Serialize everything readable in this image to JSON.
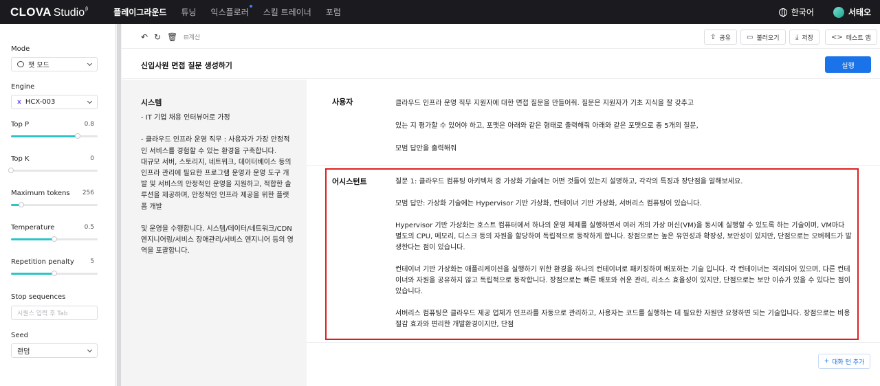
{
  "topnav": {
    "logo_bold": "CLOVA",
    "logo_regular": "Studio",
    "logo_sup": "β",
    "items": [
      {
        "label": "플레이그라운드",
        "active": true
      },
      {
        "label": "튜닝",
        "active": false
      },
      {
        "label": "익스플로러",
        "active": false,
        "dot": true
      },
      {
        "label": "스킬 트레이너",
        "active": false
      },
      {
        "label": "포럼",
        "active": false
      }
    ],
    "language": "한국어",
    "user_name": "서태오"
  },
  "sidebar": {
    "mode_label": "Mode",
    "mode_value": "챗 모드",
    "engine_label": "Engine",
    "engine_value": "HCX-003",
    "top_p_label": "Top P",
    "top_p_value": "0.8",
    "top_k_label": "Top K",
    "top_k_value": "0",
    "max_tokens_label": "Maximum tokens",
    "max_tokens_value": "256",
    "temperature_label": "Temperature",
    "temperature_value": "0.5",
    "repetition_label": "Repetition penalty",
    "repetition_value": "5",
    "stop_label": "Stop sequences",
    "stop_placeholder": "시퀀스 입력 후 Tab",
    "seed_label": "Seed",
    "seed_value": "랜덤",
    "accent_color": "#2cc4c9"
  },
  "toolbar": {
    "token_label": "계산",
    "share": "공유",
    "load": "불러오기",
    "save": "저장",
    "test_app": "테스트 앱"
  },
  "main": {
    "title": "신입사원 면접 질문 생성하기",
    "run_label": "실행",
    "system_title": "시스템",
    "system_text": "- IT 기업 채용 인터뷰어로 가정\n\n- 클라우드 인프라 운영 직무 : 사용자가 가장 안정적인 서비스를 경험할 수 있는 환경을 구축합니다.\n대규모 서버, 스토리지, 네트워크, 데이터베이스 등의 인프라 관리에 필요한 프로그램 운영과 운영 도구 개발 및 서비스의 안정적인 운영을 지원하고, 적합한 솔루션을 제공하며, 안정적인 인프라 제공을 위한 플랫폼 개발\n\n및 운영을 수행합니다. 시스템/데이터/네트워크/CDN 엔지니어링/서비스 장애관리/서비스 엔지니어 등의 영역을 포괄합니다.",
    "user_role": "사용자",
    "user_lines": [
      "클라우드 인프라 운영 직무 지원자에 대한 면접 질문을 만들어줘. 질문은 지원자가 기초 지식을 잘 갖추고",
      "있는 지 평가할 수 있어야 하고, 포맷은 아래와 같은 형태로 출력해줘 아래와 같은 포맷으로 총 5개의 질문,",
      "모범 답안을 출력해줘"
    ],
    "assistant_role": "어시스턴트",
    "assistant_paragraphs": [
      "질문 1: 클라우드 컴퓨팅 아키텍처 중 가상화 기술에는 어떤 것들이 있는지 설명하고, 각각의 특징과 장단점을 말해보세요.",
      "모범 답안: 가상화 기술에는 Hypervisor 기반 가상화, 컨테이너 기반 가상화, 서버리스 컴퓨팅이 있습니다.",
      "Hypervisor 기반 가상화는 호스트 컴퓨터에서 하나의 운영 체제를 실행하면서 여러 개의 가상 머신(VM)을 동시에 실행할 수 있도록 하는 기술이며, VM마다 별도의 CPU, 메모리, 디스크 등의 자원을 할당하여 독립적으로 동작하게 합니다. 장점으로는 높은 유연성과 확장성, 보안성이 있지만, 단점으로는 오버헤드가 발생한다는 점이 있습니다.",
      "컨테이너 기반 가상화는 애플리케이션을 실행하기 위한 환경을 하나의 컨테이너로 패키징하여 배포하는 기술 입니다. 각 컨테이너는 격리되어 있으며, 다른 컨테이너와 자원을 공유하지 않고 독립적으로 동작합니다. 장점으로는 빠른 배포와 쉬운 관리, 리소스 효율성이 있지만, 단점으로는 보안 이슈가 있을 수 있다는 점이 있습니다.",
      "서버리스 컴퓨팅은 클라우드 제공 업체가 인프라를 자동으로 관리하고, 사용자는 코드를 실행하는 데 필요한 자원만 요청하면 되는 기술입니다. 장점으로는 비용 절감 효과와 편리한 개발환경이지만, 단점"
    ],
    "add_turn_label": "대화 턴 추가",
    "highlight_color": "#e01e1e",
    "primary_color": "#1a73e8"
  }
}
